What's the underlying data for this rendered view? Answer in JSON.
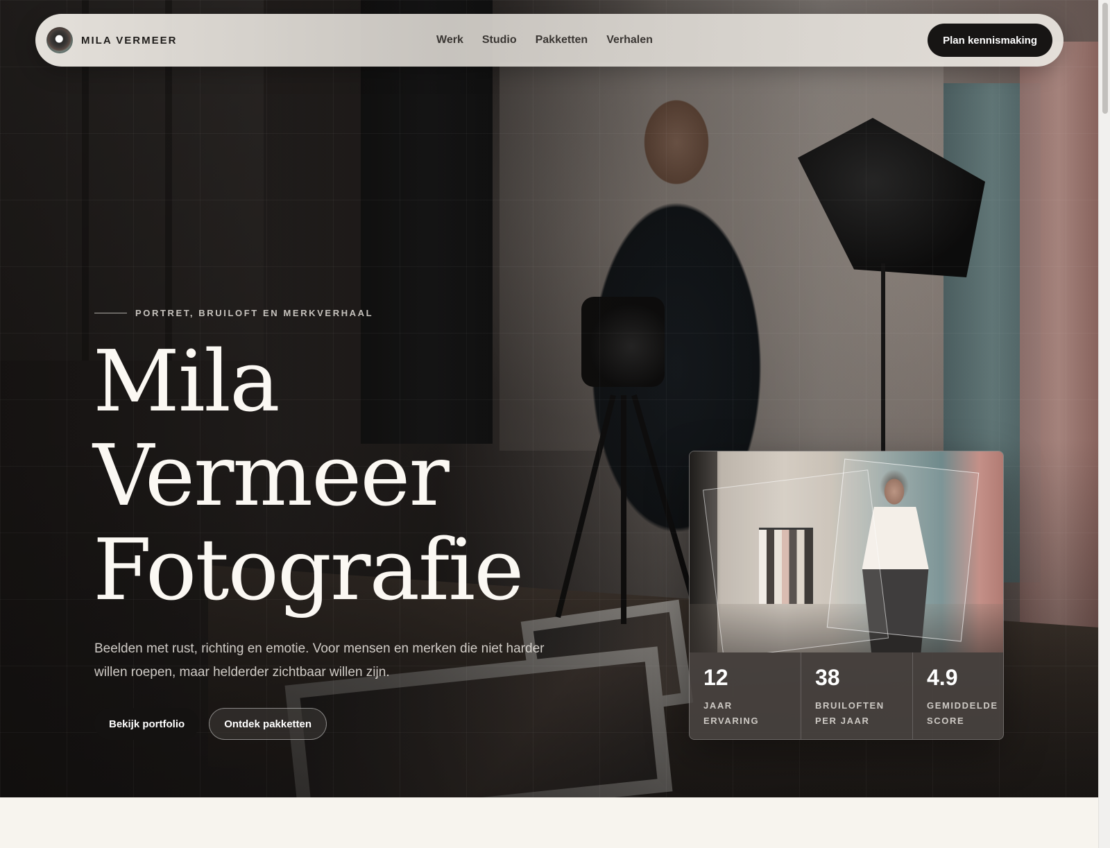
{
  "nav": {
    "brand_name": "MILA VERMEER",
    "links": [
      "Werk",
      "Studio",
      "Pakketten",
      "Verhalen"
    ],
    "cta_label": "Plan kennismaking"
  },
  "hero": {
    "eyebrow": "PORTRET, BRUILOFT EN MERKVERHAAL",
    "title_lines": [
      "Mila",
      "Vermeer",
      "Fotografie"
    ],
    "subtitle": "Beelden met rust, richting en emotie. Voor mensen en merken die niet harder willen roepen, maar helderder zichtbaar willen zijn.",
    "primary_button": "Bekijk portfolio",
    "secondary_button": "Ontdek pakketten"
  },
  "card": {
    "stats": [
      {
        "value": "12",
        "label": "JAAR\nERVARING"
      },
      {
        "value": "38",
        "label": "BRUILOFTEN\nPER JAAR"
      },
      {
        "value": "4.9",
        "label": "GEMIDDELDE\nSCORE"
      }
    ]
  }
}
